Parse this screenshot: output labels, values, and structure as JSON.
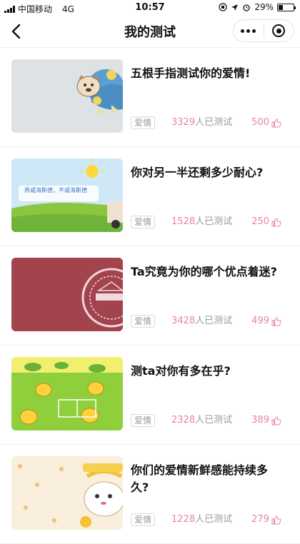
{
  "status_bar": {
    "carrier": "中国移动",
    "network": "4G",
    "time": "10:57",
    "battery_percent": "29%",
    "battery_level": 0.29
  },
  "nav": {
    "title": "我的测试",
    "back_icon": "chevron-left-icon",
    "more_icon": "more-dots-icon",
    "close_icon": "target-icon"
  },
  "items": [
    {
      "title": "五根手指测试你的爱情!",
      "tag": "爱情",
      "count": "3329",
      "count_suffix": "人已测试",
      "likes": "500"
    },
    {
      "title": "你对另一半还剩多少耐心?",
      "tag": "爱情",
      "count": "1528",
      "count_suffix": "人已测试",
      "likes": "250",
      "thumb_text": "再咸海斯德，不咸海斯德"
    },
    {
      "title": "Ta究竟为你的哪个优点着迷?",
      "tag": "爱情",
      "count": "3428",
      "count_suffix": "人已测试",
      "likes": "499"
    },
    {
      "title": "测ta对你有多在乎?",
      "tag": "爱情",
      "count": "2328",
      "count_suffix": "人已测试",
      "likes": "389"
    },
    {
      "title": "你们的爱情新鲜感能持续多久?",
      "tag": "爱情",
      "count": "1228",
      "count_suffix": "人已测试",
      "likes": "279"
    }
  ],
  "colors": {
    "accent": "#e8859a",
    "muted": "#9a9a9a"
  }
}
